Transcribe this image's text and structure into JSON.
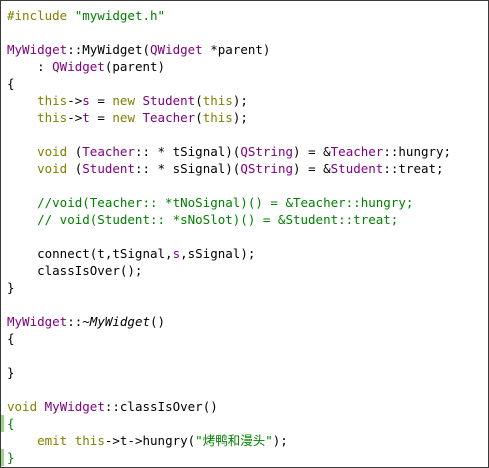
{
  "colors": {
    "plain": "#000000",
    "keyword": "#808000",
    "type": "#800080",
    "string": "#008000",
    "comment": "#008000",
    "func": "#000000",
    "italic": "#000000",
    "paren_match": "#000000",
    "caret_bar": "#9bd68f"
  },
  "code_lines": [
    [
      {
        "t": "#include ",
        "c": "keyword"
      },
      {
        "t": "\"mywidget.h\"",
        "c": "string"
      }
    ],
    [],
    [
      {
        "t": "MyWidget",
        "c": "type"
      },
      {
        "t": "::",
        "c": "plain"
      },
      {
        "t": "MyWidget",
        "c": "plain"
      },
      {
        "t": "(",
        "c": "plain"
      },
      {
        "t": "QWidget",
        "c": "type"
      },
      {
        "t": " *parent)",
        "c": "plain"
      }
    ],
    [
      {
        "t": "    : ",
        "c": "plain"
      },
      {
        "t": "QWidget",
        "c": "type"
      },
      {
        "t": "(parent)",
        "c": "plain"
      }
    ],
    [
      {
        "t": "{",
        "c": "plain"
      }
    ],
    [
      {
        "t": "    ",
        "c": "plain"
      },
      {
        "t": "this",
        "c": "keyword"
      },
      {
        "t": "->",
        "c": "plain"
      },
      {
        "t": "s",
        "c": "type"
      },
      {
        "t": " = ",
        "c": "plain"
      },
      {
        "t": "new",
        "c": "keyword"
      },
      {
        "t": " ",
        "c": "plain"
      },
      {
        "t": "Student",
        "c": "type"
      },
      {
        "t": "(",
        "c": "plain"
      },
      {
        "t": "this",
        "c": "keyword"
      },
      {
        "t": ");",
        "c": "plain"
      }
    ],
    [
      {
        "t": "    ",
        "c": "plain"
      },
      {
        "t": "this",
        "c": "keyword"
      },
      {
        "t": "->",
        "c": "plain"
      },
      {
        "t": "t",
        "c": "type"
      },
      {
        "t": " = ",
        "c": "plain"
      },
      {
        "t": "new",
        "c": "keyword"
      },
      {
        "t": " ",
        "c": "plain"
      },
      {
        "t": "Teacher",
        "c": "type"
      },
      {
        "t": "(",
        "c": "plain"
      },
      {
        "t": "this",
        "c": "keyword"
      },
      {
        "t": ");",
        "c": "plain"
      }
    ],
    [],
    [
      {
        "t": "    ",
        "c": "plain"
      },
      {
        "t": "void",
        "c": "keyword"
      },
      {
        "t": " (",
        "c": "plain"
      },
      {
        "t": "Teacher",
        "c": "type"
      },
      {
        "t": ":: * tSignal)(",
        "c": "plain"
      },
      {
        "t": "QString",
        "c": "type"
      },
      {
        "t": ") = &",
        "c": "plain"
      },
      {
        "t": "Teacher",
        "c": "type"
      },
      {
        "t": "::hungry;",
        "c": "plain"
      }
    ],
    [
      {
        "t": "    ",
        "c": "plain"
      },
      {
        "t": "void",
        "c": "keyword"
      },
      {
        "t": " (",
        "c": "plain"
      },
      {
        "t": "Student",
        "c": "type"
      },
      {
        "t": ":: * sSignal)(",
        "c": "plain"
      },
      {
        "t": "QString",
        "c": "type"
      },
      {
        "t": ") = &",
        "c": "plain"
      },
      {
        "t": "Student",
        "c": "type"
      },
      {
        "t": "::treat;",
        "c": "plain"
      }
    ],
    [],
    [
      {
        "t": "    //void(Teacher:: *tNoSignal)() = &Teacher::hungry;",
        "c": "comment"
      }
    ],
    [
      {
        "t": "    // void(Student:: *sNoSlot)() = &Student::treat;",
        "c": "comment"
      }
    ],
    [],
    [
      {
        "t": "    connect(t,tSignal,",
        "c": "plain"
      },
      {
        "t": "s",
        "c": "type"
      },
      {
        "t": ",sSignal);",
        "c": "plain"
      }
    ],
    [
      {
        "t": "    classIsOver();",
        "c": "plain"
      }
    ],
    [
      {
        "t": "}",
        "c": "plain"
      }
    ],
    [],
    [
      {
        "t": "MyWidget",
        "c": "type"
      },
      {
        "t": "::~",
        "c": "plain"
      },
      {
        "t": "MyWidget",
        "c": "italic"
      },
      {
        "t": "()",
        "c": "plain"
      }
    ],
    [
      {
        "t": "{",
        "c": "plain"
      }
    ],
    [],
    [
      {
        "t": "}",
        "c": "plain"
      }
    ],
    [],
    [
      {
        "t": "void",
        "c": "keyword"
      },
      {
        "t": " ",
        "c": "plain"
      },
      {
        "t": "MyWidget",
        "c": "type"
      },
      {
        "t": "::classIsOver()",
        "c": "plain"
      }
    ],
    [
      {
        "t": "{",
        "c": "string"
      }
    ],
    [
      {
        "t": "    ",
        "c": "plain"
      },
      {
        "t": "emit",
        "c": "keyword"
      },
      {
        "t": " ",
        "c": "plain"
      },
      {
        "t": "this",
        "c": "keyword"
      },
      {
        "t": "->t->hungry(",
        "c": "plain"
      },
      {
        "t": "\"烤鸭和漫头\"",
        "c": "string"
      },
      {
        "t": ");",
        "c": "plain"
      }
    ],
    [
      {
        "t": "}",
        "c": "string"
      }
    ]
  ]
}
